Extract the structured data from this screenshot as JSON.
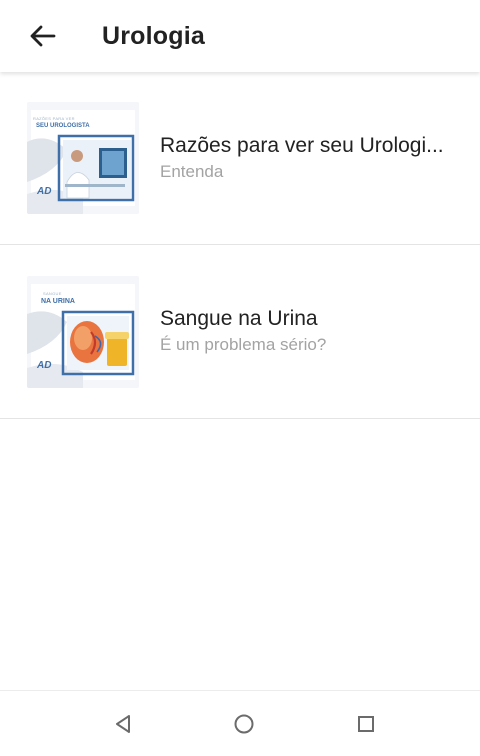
{
  "appbar": {
    "title": "Urologia",
    "back_icon": "arrow-left-icon"
  },
  "items": [
    {
      "title": "Razões para ver seu Urologi...",
      "subtitle": "Entenda",
      "thumb_caption_small": "RAZÕES PARA VER",
      "thumb_caption": "SEU UROLOGISTA"
    },
    {
      "title": "Sangue na Urina",
      "subtitle": "É um problema sério?",
      "thumb_caption_small": "SANGUE",
      "thumb_caption": "NA URINA"
    }
  ],
  "navbar": {
    "back_icon": "triangle-back-icon",
    "home_icon": "circle-home-icon",
    "recents_icon": "square-recents-icon"
  },
  "colors": {
    "title": "#222222",
    "subtitle": "#a3a3a3",
    "accent_blue": "#3f6fa8"
  }
}
